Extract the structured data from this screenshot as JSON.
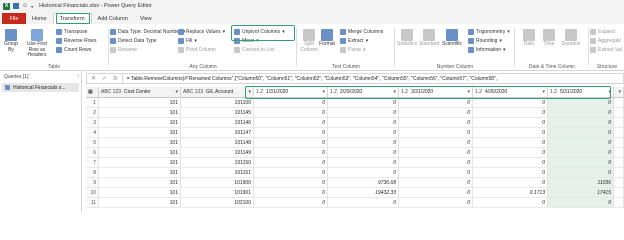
{
  "window": {
    "title": "Historical Financials.xlsx - Power Query Editor"
  },
  "tabs": [
    "File",
    "Home",
    "Transform",
    "Add Column",
    "View"
  ],
  "ribbon": {
    "table_group": {
      "label": "Table",
      "group_by": "Group By",
      "use_first_row": "Use First Row as Headers",
      "transpose": "Transpose",
      "reverse_rows": "Reverse Rows",
      "count_rows": "Count Rows"
    },
    "any_column_group": {
      "label": "Any Column",
      "data_type": "Data Type: Decimal Number",
      "detect": "Detect Data Type",
      "rename": "Rename",
      "replace_values": "Replace Values",
      "fill": "Fill",
      "pivot_column": "Pivot Column",
      "unpivot": "Unpivot Columns",
      "move": "Move",
      "convert_to_list": "Convert to List"
    },
    "text_column_group": {
      "label": "Text Column",
      "split": "Split Column",
      "format": "Format",
      "merge": "Merge Columns",
      "extract": "Extract",
      "parse": "Parse"
    },
    "number_column_group": {
      "label": "Number Column",
      "statistics": "Statistics",
      "standard": "Standard",
      "scientific": "Scientific",
      "trig": "Trigonometry",
      "rounding": "Rounding",
      "information": "Information"
    },
    "datetime_group": {
      "label": "Date & Time Column",
      "date": "Date",
      "time": "Time",
      "duration": "Duration"
    },
    "structured_group": {
      "label": "Structure",
      "expand": "Expand",
      "aggregate": "Aggregate",
      "extract_values": "Extract Val"
    }
  },
  "queries_panel": {
    "header": "Queries [1]",
    "item": "Historical Financials s..."
  },
  "formula": {
    "fx": "fx",
    "text": "= Table.RemoveColumns(#\"Renamed Columns\",{\"Column50\", \"Column51\", \"Column52\", \"Column53\", \"Column54\", \"Column55\", \"Column56\", \"Column57\", \"Column58\","
  },
  "columns": [
    {
      "type": "ABC 123",
      "name": "Cost Center"
    },
    {
      "type": "ABC 123",
      "name": "G/L Account"
    },
    {
      "type": "1.2",
      "name": "1/31/2020"
    },
    {
      "type": "1.2",
      "name": "2/29/2020"
    },
    {
      "type": "1.2",
      "name": "3/31/2020"
    },
    {
      "type": "1.2",
      "name": "4/30/2020"
    },
    {
      "type": "1.2",
      "name": "5/31/2020"
    }
  ],
  "rows": [
    {
      "n": "1",
      "cc": "101",
      "gl": "101100",
      "v": [
        "0",
        "0",
        "0",
        "0",
        "0"
      ]
    },
    {
      "n": "2",
      "cc": "101",
      "gl": "101145",
      "v": [
        "0",
        "0",
        "0",
        "0",
        "0"
      ]
    },
    {
      "n": "3",
      "cc": "101",
      "gl": "101146",
      "v": [
        "0",
        "0",
        "0",
        "0",
        "0"
      ]
    },
    {
      "n": "4",
      "cc": "101",
      "gl": "101147",
      "v": [
        "0",
        "0",
        "0",
        "0",
        "0"
      ]
    },
    {
      "n": "5",
      "cc": "101",
      "gl": "101148",
      "v": [
        "0",
        "0",
        "0",
        "0",
        "0"
      ]
    },
    {
      "n": "6",
      "cc": "101",
      "gl": "101149",
      "v": [
        "0",
        "0",
        "0",
        "0",
        "0"
      ]
    },
    {
      "n": "7",
      "cc": "101",
      "gl": "101150",
      "v": [
        "0",
        "0",
        "0",
        "0",
        "0"
      ]
    },
    {
      "n": "8",
      "cc": "101",
      "gl": "101151",
      "v": [
        "0",
        "0",
        "0",
        "0",
        "0"
      ]
    },
    {
      "n": "9",
      "cc": "101",
      "gl": "101900",
      "v": [
        "0",
        "9736.68",
        "0",
        "0",
        "11036"
      ]
    },
    {
      "n": "10",
      "cc": "101",
      "gl": "101901",
      "v": [
        "0",
        "19432.33",
        "0",
        "0.1713",
        "17415"
      ]
    },
    {
      "n": "11",
      "cc": "101",
      "gl": "102100",
      "v": [
        "0",
        "0",
        "0",
        "0",
        "0"
      ]
    }
  ],
  "colors": {
    "accent": "#2e9e7b",
    "file_tab": "#c42b1c",
    "excel": "#217346",
    "hl_cell": "#e4f0e9"
  }
}
